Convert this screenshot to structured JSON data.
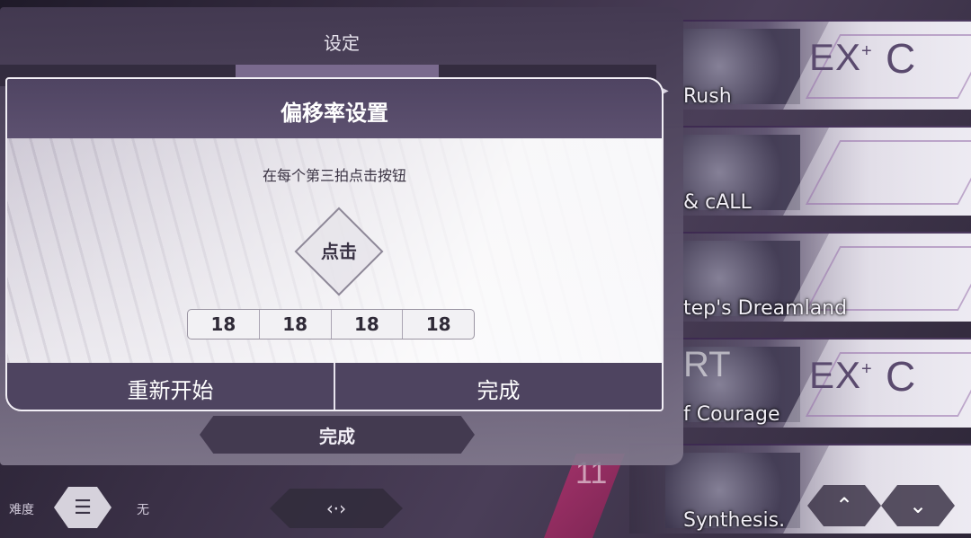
{
  "settings": {
    "title": "设定",
    "done_label": "完成"
  },
  "offset_dialog": {
    "title": "偏移率设置",
    "instruction": "在每个第三拍点击按钮",
    "tap_button_label": "点击",
    "tap_values": [
      "18",
      "18",
      "18",
      "18"
    ],
    "restart_label": "重新开始",
    "done_label": "完成"
  },
  "song_list": [
    {
      "title": "Rush",
      "ghost_text": "",
      "difficulty": "EX",
      "difficulty_mark": "+",
      "grade": "C"
    },
    {
      "title": "& cALL",
      "ghost_text": "",
      "difficulty": "",
      "difficulty_mark": "",
      "grade": ""
    },
    {
      "title": "tep's Dreamland",
      "ghost_text": "",
      "difficulty": "",
      "difficulty_mark": "",
      "grade": ""
    },
    {
      "title": "f Courage",
      "ghost_text": "RT",
      "difficulty": "EX",
      "difficulty_mark": "+",
      "grade": "C"
    },
    {
      "title": "Synthesis.",
      "ghost_text": "",
      "difficulty": "",
      "difficulty_mark": "",
      "grade": ""
    }
  ],
  "level_number": "11",
  "bottom_bar": {
    "difficulty_label": "难度",
    "filter_icon": "sliders-icon",
    "filter_value": "无",
    "random_icon": "diamond-arrows-icon"
  },
  "scroll": {
    "up_icon": "chevron-up-icon",
    "down_icon": "chevron-down-icon"
  },
  "colors": {
    "panel": "#4f4462",
    "accent_level": "#a5336b",
    "text_dark": "#3a3345"
  }
}
